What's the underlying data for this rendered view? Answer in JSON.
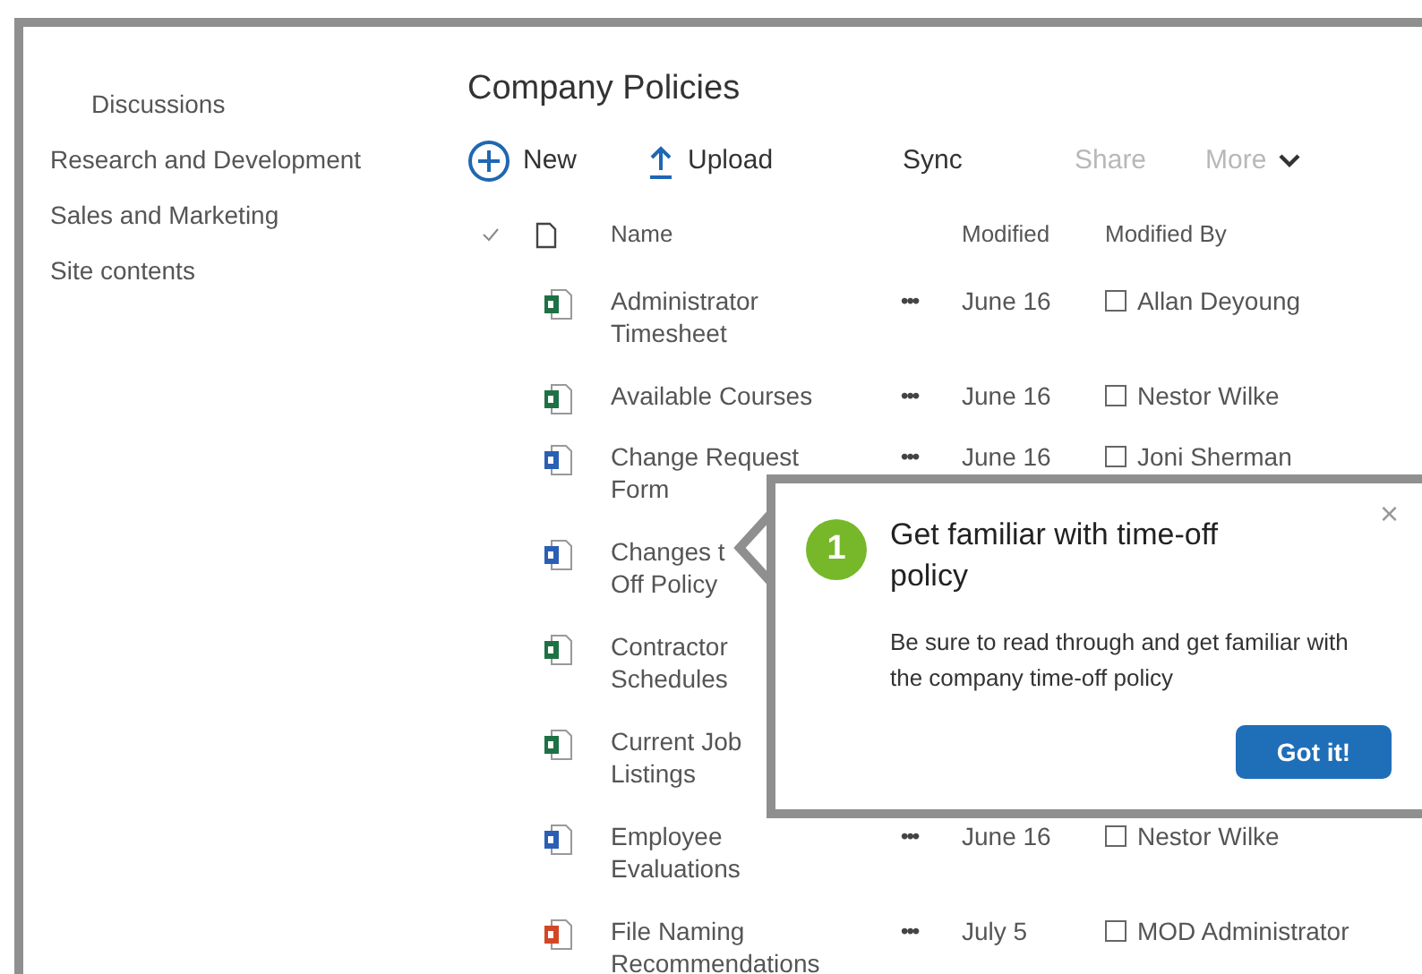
{
  "sidebar": {
    "items": [
      {
        "label": "Discussions",
        "indented": true
      },
      {
        "label": "Research and Development",
        "indented": false
      },
      {
        "label": "Sales and Marketing",
        "indented": false
      },
      {
        "label": "Site contents",
        "indented": false
      }
    ]
  },
  "page_title": "Company Policies",
  "toolbar": [
    {
      "kind": "new",
      "label": "New",
      "disabled": false
    },
    {
      "kind": "upload",
      "label": "Upload",
      "disabled": false
    },
    {
      "kind": "plain",
      "label": "Sync",
      "disabled": false
    },
    {
      "kind": "plain",
      "label": "Share",
      "disabled": true
    },
    {
      "kind": "more",
      "label": "More",
      "disabled": true
    }
  ],
  "table": {
    "columns": [
      "Name",
      "Modified",
      "Modified By"
    ],
    "rows": [
      {
        "kind": "excel",
        "name": [
          "Administrator",
          "Timesheet"
        ],
        "menu": "•••",
        "modified": "June 16",
        "checked": false,
        "modified_by": "Allan Deyoung"
      },
      {
        "kind": "excel",
        "name": [
          "Available Courses"
        ],
        "menu": "•••",
        "modified": "June 16",
        "checked": false,
        "modified_by": "Nestor Wilke"
      },
      {
        "kind": "word",
        "name": [
          "Change Request",
          "Form"
        ],
        "menu": "•••",
        "modified": "June 16",
        "checked": false,
        "modified_by": "Joni Sherman"
      },
      {
        "kind": "word",
        "name": [
          "Changes t",
          "Off Policy"
        ]
      },
      {
        "kind": "excel",
        "name": [
          "Contractor",
          "Schedules"
        ]
      },
      {
        "kind": "excel",
        "name": [
          "Current Job",
          "Listings"
        ]
      },
      {
        "kind": "word",
        "name": [
          "Employee",
          "Evaluations"
        ],
        "menu": "•••",
        "modified": "June 16",
        "checked": false,
        "modified_by": "Nestor Wilke"
      },
      {
        "kind": "pdf",
        "name": [
          "File Naming",
          "Recommendations"
        ],
        "menu": "•••",
        "modified": "July 5",
        "checked": false,
        "modified_by": "MOD Administrator"
      }
    ]
  },
  "callout": {
    "step": "1",
    "title": "Get familiar with time-off policy",
    "body": "Be sure to read through and get familiar with the company time-off policy",
    "close": "×",
    "button": "Got it!"
  }
}
